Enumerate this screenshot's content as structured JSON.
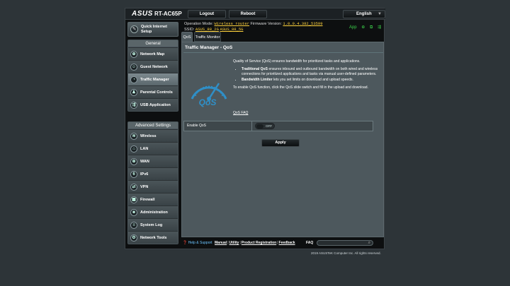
{
  "header": {
    "brand": "ASUS",
    "model": "RT-AC65P",
    "logout_label": "Logout",
    "reboot_label": "Reboot",
    "language": "English"
  },
  "info": {
    "operation_mode_label": "Operation Mode:",
    "operation_mode": "Wireless router",
    "firmware_label": "Firmware Version:",
    "firmware": "1.0.0.4.382_53599",
    "ssid_label": "SSID:",
    "ssid_24": "ASUS_88_2G",
    "ssid_5": "ASUS_88_5G",
    "app_label": "App"
  },
  "sidebar": {
    "qis_label": "Quick Internet Setup",
    "general_header": "General",
    "general_items": [
      {
        "label": "Network Map"
      },
      {
        "label": "Guest Network"
      },
      {
        "label": "Traffic Manager"
      },
      {
        "label": "Parental Controls"
      },
      {
        "label": "USB Application"
      }
    ],
    "advanced_header": "Advanced Settings",
    "advanced_items": [
      {
        "label": "Wireless"
      },
      {
        "label": "LAN"
      },
      {
        "label": "WAN"
      },
      {
        "label": "IPv6"
      },
      {
        "label": "VPN"
      },
      {
        "label": "Firewall"
      },
      {
        "label": "Administration"
      },
      {
        "label": "System Log"
      },
      {
        "label": "Network Tools"
      }
    ]
  },
  "tabs": [
    "QoS",
    "Traffic Monitor"
  ],
  "panel": {
    "title": "Traffic Manager - QoS",
    "intro": "Quality of Service (QoS) ensures bandwidth for prioritized tasks and applications.",
    "bullet1_title": "Traditional QoS",
    "bullet1_text": " ensures inbound and outbound bandwidth on both wired and wireless connections for prioritized applications and tasks via manual user-defined parameters.",
    "bullet2_title": "Bandwidth Limiter",
    "bullet2_text": " lets you set limits on download and upload speeds.",
    "enable_hint": "To enable QoS function, click the QoS slide switch and fill in the upload and download.",
    "faq_link": "QoS FAQ",
    "logo_text": "QoS",
    "enable_label": "Enable QoS",
    "toggle_state": "OFF",
    "apply_label": "Apply"
  },
  "footer": {
    "help_label": "Help & Support",
    "manual": "Manual",
    "utility": "Utility",
    "registration": "Product Registration",
    "feedback": "Feedback",
    "separator": "|",
    "faq_label": "FAQ"
  },
  "copyright": "2019 ASUSTeK Computer Inc. All rights reserved.",
  "colors": {
    "accent_link": "#ffd33d",
    "status_green": "#3bd04a",
    "qos_logo": "#2f8fc7"
  }
}
